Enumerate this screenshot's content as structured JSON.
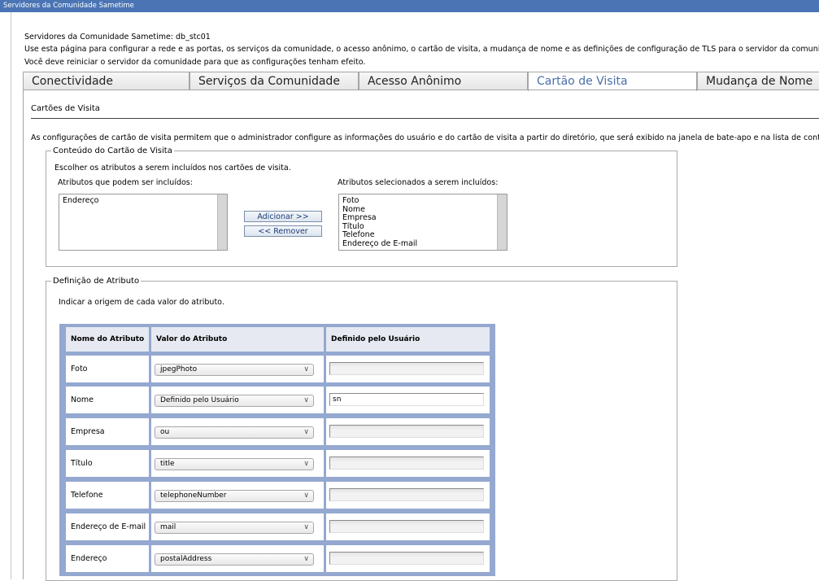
{
  "window": {
    "title": "Servidores da Comunidade Sametime"
  },
  "header": {
    "server_line": "Servidores da Comunidade Sametime: db_stc01",
    "description": "Use esta página para configurar a rede e as portas, os serviços da comunidade, o acesso anônimo, o cartão de visita, a mudança de nome e as definições de configuração de TLS para o servidor da comunidad",
    "restart_note": "Você deve reiniciar o servidor da comunidade para que as configurações tenham efeito."
  },
  "tabs": [
    {
      "label": "Conectividade"
    },
    {
      "label": "Serviços da Comunidade"
    },
    {
      "label": "Acesso Anônimo"
    },
    {
      "label": "Cartão de Visita"
    },
    {
      "label": "Mudança de Nome"
    }
  ],
  "section": {
    "title": "Cartões de Visita",
    "description": "As configurações de cartão de visita permitem que o administrador configure as informações do usuário e do cartão de visita a partir do diretório, que será exibido na janela de bate-apo e na lista de contat"
  },
  "content_fieldset": {
    "legend": "Conteúdo do Cartão de Visita",
    "instruction": "Escolher os atributos a serem incluídos nos cartões de visita.",
    "available_label": "Atributos que podem ser incluídos:",
    "available_items": [
      "Endereço"
    ],
    "selected_label": "Atributos selecionados a serem incluídos:",
    "selected_items": [
      "Foto",
      "Nome",
      "Empresa",
      "Título",
      "Telefone",
      "Endereço de E-mail"
    ],
    "add_button": "Adicionar >>",
    "remove_button": "<< Remover"
  },
  "attr_fieldset": {
    "legend": "Definição de Atributo",
    "instruction": "Indicar a origem de cada valor do atributo.",
    "columns": [
      "Nome do Atributo",
      "Valor do Atributo",
      "Definido pelo Usuário"
    ],
    "rows": [
      {
        "name": "Foto",
        "value": "jpegPhoto",
        "user_defined": ""
      },
      {
        "name": "Nome",
        "value": "Definido pelo Usuário",
        "user_defined": "sn"
      },
      {
        "name": "Empresa",
        "value": "ou",
        "user_defined": ""
      },
      {
        "name": "Título",
        "value": "title",
        "user_defined": ""
      },
      {
        "name": "Telefone",
        "value": "telephoneNumber",
        "user_defined": ""
      },
      {
        "name": "Endereço de E-mail",
        "value": "mail",
        "user_defined": ""
      },
      {
        "name": "Endereço",
        "value": "postalAddress",
        "user_defined": ""
      }
    ]
  }
}
